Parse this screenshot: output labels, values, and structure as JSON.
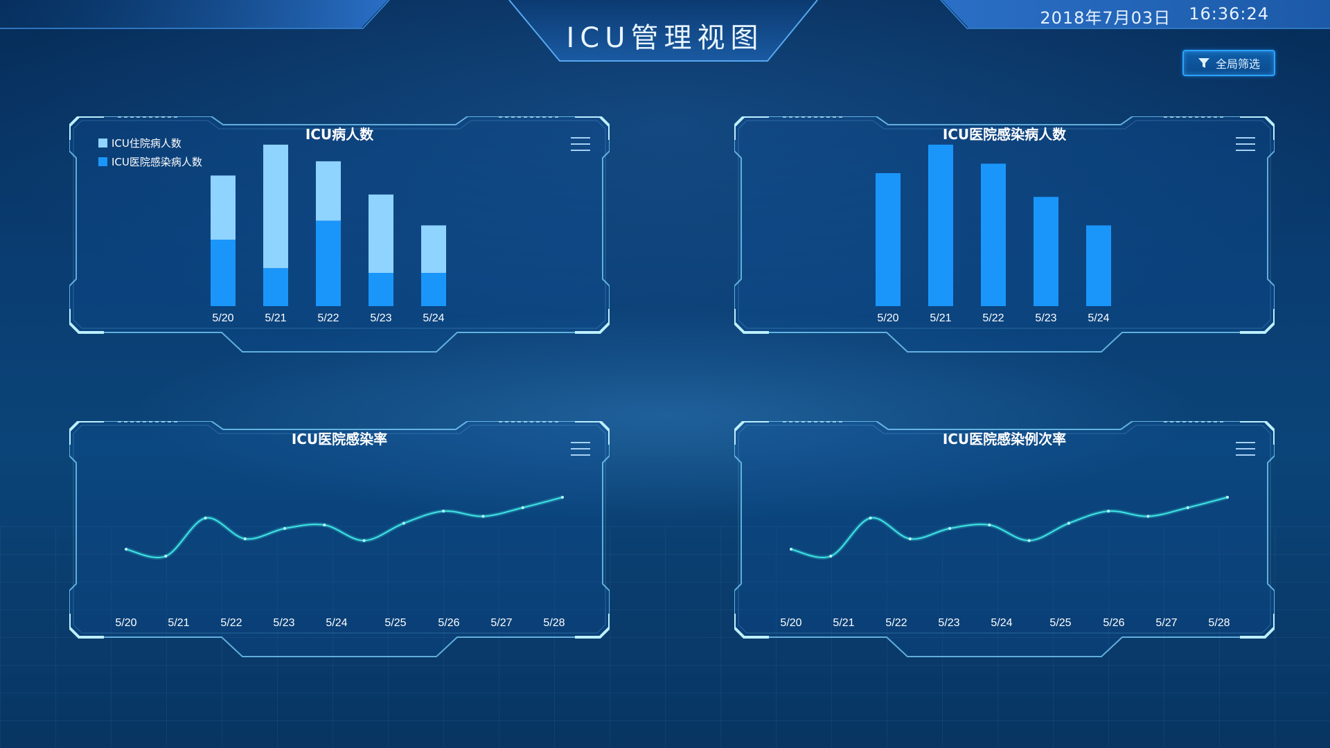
{
  "header": {
    "title": "ICU管理视图",
    "date": "2018年7月03日",
    "time": "16:36:24"
  },
  "toolbar": {
    "filter_label": "全局筛选"
  },
  "colors": {
    "light_bar": "#8fd3ff",
    "dark_bar": "#1a96fb",
    "line": "#3ee6e6",
    "frame": "#7fd6ff"
  },
  "chart_data": [
    {
      "id": "icu-patients",
      "type": "bar",
      "title": "ICU病人数",
      "stacked": true,
      "categories": [
        "5/20",
        "5/21",
        "5/22",
        "5/23",
        "5/24"
      ],
      "series": [
        {
          "name": "ICU医院感染病人数",
          "values": [
            28,
            16,
            36,
            14,
            14
          ]
        },
        {
          "name": "ICU住院病人数",
          "values": [
            27,
            52,
            25,
            33,
            20
          ]
        }
      ],
      "ylim": [
        0,
        70
      ],
      "legend": "top-left",
      "grid": false
    },
    {
      "id": "icu-infection-patients",
      "type": "bar",
      "title": "ICU医院感染病人数",
      "categories": [
        "5/20",
        "5/21",
        "5/22",
        "5/23",
        "5/24"
      ],
      "values": [
        56,
        68,
        60,
        46,
        34
      ],
      "ylim": [
        0,
        70
      ],
      "grid": false
    },
    {
      "id": "icu-infection-rate",
      "type": "line",
      "title": "ICU医院感染率",
      "x": [
        "5/20",
        "5/21",
        "5/22",
        "5/23",
        "5/24",
        "5/25",
        "5/26",
        "5/27",
        "5/28"
      ],
      "values": [
        30,
        26,
        48,
        36,
        42,
        44,
        35,
        45,
        52,
        49,
        54,
        60
      ],
      "ylim": [
        0,
        80
      ],
      "grid": false
    },
    {
      "id": "icu-infection-case-rate",
      "type": "line",
      "title": "ICU医院感染例次率",
      "x": [
        "5/20",
        "5/21",
        "5/22",
        "5/23",
        "5/24",
        "5/25",
        "5/26",
        "5/27",
        "5/28"
      ],
      "values": [
        30,
        26,
        48,
        36,
        42,
        44,
        35,
        45,
        52,
        49,
        54,
        60
      ],
      "ylim": [
        0,
        80
      ],
      "grid": false
    }
  ]
}
